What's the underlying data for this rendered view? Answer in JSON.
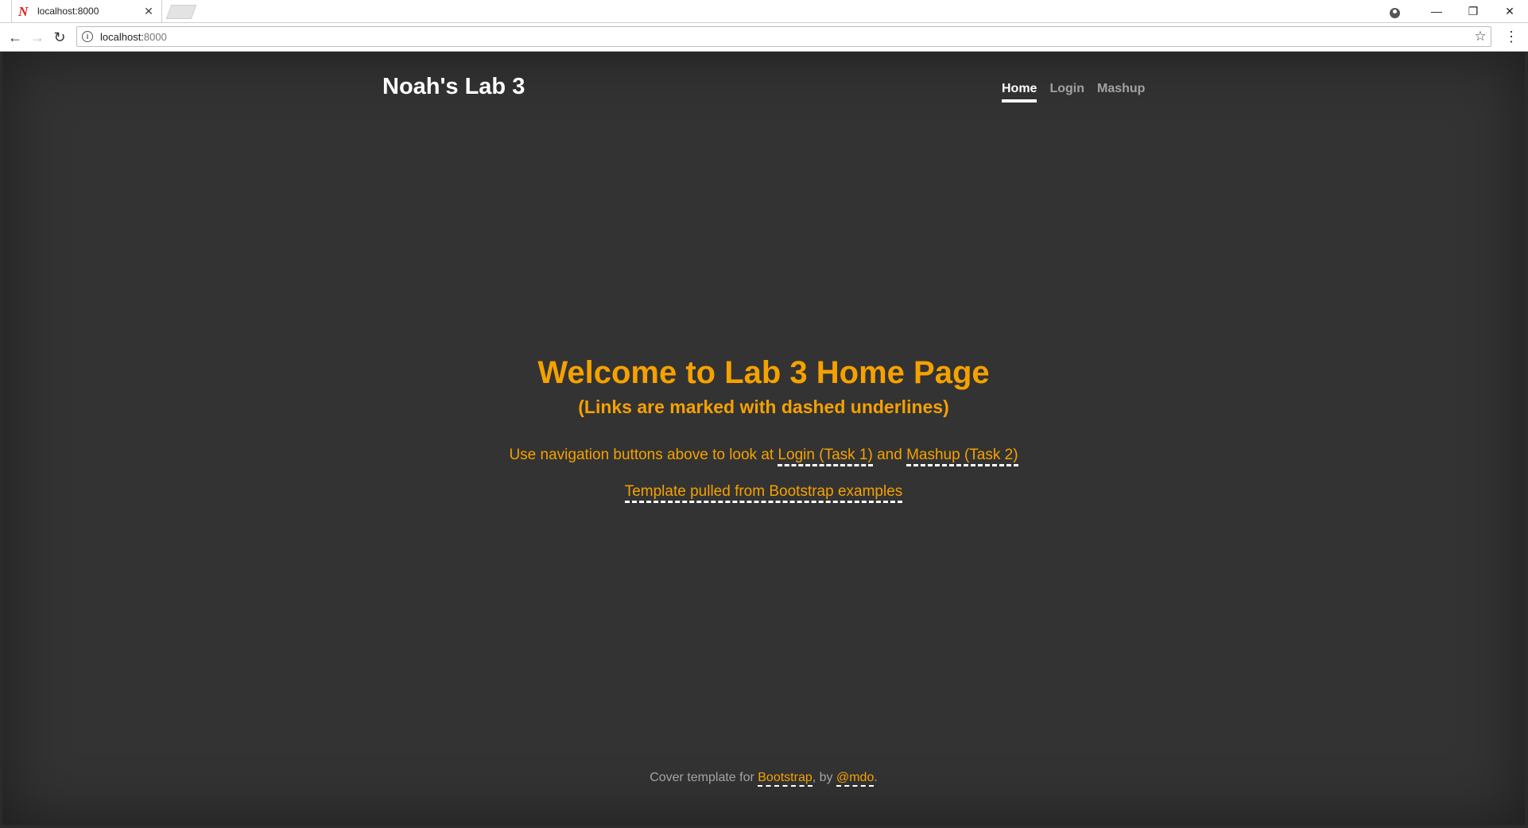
{
  "browser": {
    "tab_title": "localhost:8000",
    "favicon_letter": "N",
    "url_host": "localhost:",
    "url_port": "8000"
  },
  "site": {
    "brand": "Noah's Lab 3",
    "nav": [
      {
        "label": "Home",
        "active": true
      },
      {
        "label": "Login",
        "active": false
      },
      {
        "label": "Mashup",
        "active": false
      }
    ]
  },
  "cover": {
    "heading": "Welcome to Lab 3 Home Page",
    "subheading": "(Links are marked with dashed underlines)",
    "lead_prefix": "Use navigation buttons above to look at ",
    "login_link": "Login (Task 1)",
    "lead_middle": " and ",
    "mashup_link": "Mashup (Task 2)",
    "template_link": "Template pulled from Bootstrap examples"
  },
  "footer": {
    "prefix": "Cover template for ",
    "bootstrap_link": "Bootstrap",
    "middle": ", by ",
    "author_link": "@mdo",
    "suffix": "."
  },
  "colors": {
    "accent": "#f5a100",
    "background": "#333333",
    "nav_active": "#ffffff"
  }
}
